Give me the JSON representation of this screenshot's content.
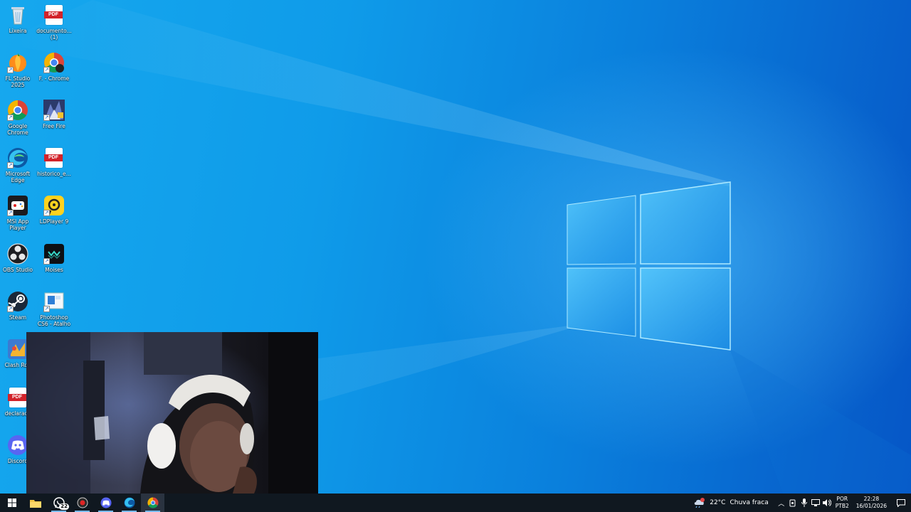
{
  "desktop": {
    "icons": [
      {
        "label": "Lixeira",
        "icon": "recycle-bin-icon"
      },
      {
        "label": "documento... (1)",
        "icon": "pdf-icon"
      },
      {
        "label": "FL Studio 2025",
        "icon": "fl-studio-icon"
      },
      {
        "label": "F. - Chrome",
        "icon": "chrome-profile-icon"
      },
      {
        "label": "Google Chrome",
        "icon": "chrome-icon"
      },
      {
        "label": "Free Fire",
        "icon": "free-fire-icon"
      },
      {
        "label": "Microsoft Edge",
        "icon": "edge-icon"
      },
      {
        "label": "historico_e...",
        "icon": "pdf-icon"
      },
      {
        "label": "MSI App Player",
        "icon": "msi-app-player-icon"
      },
      {
        "label": "LDPlayer 9",
        "icon": "ldplayer-icon"
      },
      {
        "label": "OBS Studio",
        "icon": "obs-icon"
      },
      {
        "label": "Moises",
        "icon": "moises-icon"
      },
      {
        "label": "Steam",
        "icon": "steam-icon"
      },
      {
        "label": "Photoshop CS6 - Atalho",
        "icon": "photoshop-icon"
      },
      {
        "label": "Clash Roy",
        "icon": "clash-royale-icon"
      },
      {
        "label": "declaraca",
        "icon": "pdf-icon"
      },
      {
        "label": "Discord",
        "icon": "discord-icon"
      }
    ],
    "pdf_text": "PDF"
  },
  "taskbar": {
    "apps": [
      {
        "name": "start",
        "icon": "windows-start-icon"
      },
      {
        "name": "file-explorer",
        "icon": "folder-icon"
      },
      {
        "name": "whatsapp",
        "icon": "whatsapp-icon",
        "badge": "22"
      },
      {
        "name": "obs",
        "icon": "record-icon"
      },
      {
        "name": "discord-ptb",
        "icon": "discord-icon"
      },
      {
        "name": "edge",
        "icon": "edge-icon"
      },
      {
        "name": "chrome",
        "icon": "chrome-icon"
      }
    ],
    "weather": {
      "temp": "22°C",
      "condition": "Chuva fraca"
    },
    "language": {
      "lang": "POR",
      "layout": "PTB2"
    },
    "clock": {
      "time": "22:28",
      "date": "16/01/2026"
    }
  },
  "colors": {
    "accent": "#76b9ed",
    "taskbar": "#101820",
    "wallpaper": "#0f9be9"
  }
}
